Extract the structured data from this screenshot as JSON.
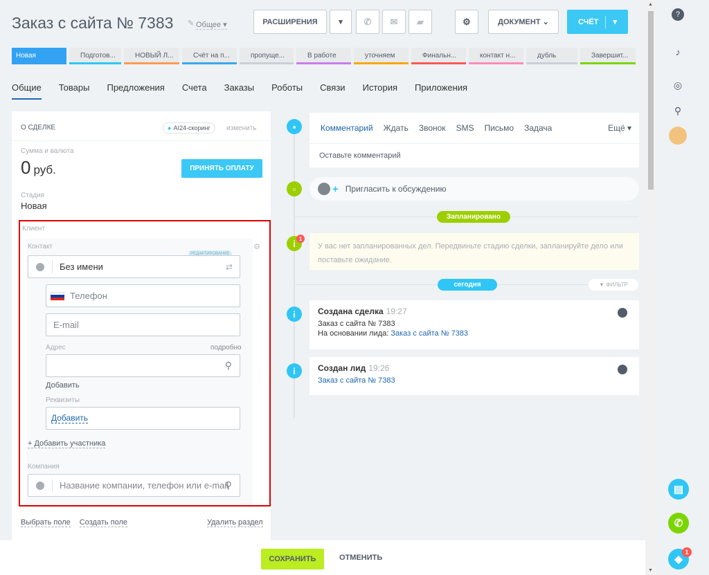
{
  "header": {
    "title": "Заказ с сайта № 7383",
    "edit_icon": "✎",
    "category": "Общее",
    "extensions_label": "РАСШИРЕНИЯ",
    "document_label": "ДОКУМЕНТ",
    "bill_label": "СЧЁТ"
  },
  "stages": [
    {
      "label": "Новая",
      "color": "#33a2f3"
    },
    {
      "label": "Подготов...",
      "color": "#2fc6f6"
    },
    {
      "label": "НОВЫЙ Л...",
      "color": "#ff9b53"
    },
    {
      "label": "Счёт на п...",
      "color": "#39a8ef"
    },
    {
      "label": "пропуще...",
      "color": "#c9d0d6"
    },
    {
      "label": "В работе",
      "color": "#c97cee"
    },
    {
      "label": "уточняем",
      "color": "#f7a700"
    },
    {
      "label": "Финальн...",
      "color": "#ff5752"
    },
    {
      "label": "контакт н...",
      "color": "#ff8ab9"
    },
    {
      "label": "дубль",
      "color": "#c9d0d6"
    },
    {
      "label": "Завершит...",
      "color": "#7bd500"
    }
  ],
  "tabs": [
    "Общие",
    "Товары",
    "Предложения",
    "Счета",
    "Заказы",
    "Роботы",
    "Связи",
    "История",
    "Приложения"
  ],
  "left": {
    "section_title": "О СДЕЛКЕ",
    "ai_badge": "AI24-скоринг",
    "change_link": "изменить",
    "sum_label": "Сумма и валюта",
    "sum_value": "0",
    "currency": "руб.",
    "pay_button": "ПРИНЯТЬ ОПЛАТУ",
    "stage_label": "Стадия",
    "stage_value": "Новая",
    "client_label": "Клиент",
    "contact_label": "Контакт",
    "edit_badge": "РЕДАКТИРОВАНИЕ",
    "name_value": "Без имени",
    "phone_placeholder": "Телефон",
    "email_placeholder": "E-mail",
    "address_label": "Адрес",
    "more_link": "подробно",
    "add_link": "Добавить",
    "requisites_label": "Реквизиты",
    "requisites_add": "Добавить",
    "add_member": "+ Добавить участника",
    "company_label": "Компания",
    "company_placeholder": "Название компании, телефон или e-mail",
    "select_field": "Выбрать поле",
    "create_field": "Создать поле",
    "delete_section": "Удалить раздел"
  },
  "timeline": {
    "editor_tabs": [
      "Комментарий",
      "Ждать",
      "Звонок",
      "SMS",
      "Письмо",
      "Задача"
    ],
    "editor_more": "Ещё",
    "editor_placeholder": "Оставьте комментарий",
    "invite": "Пригласить к обсуждению",
    "planned_pill": "Запланировано",
    "notice_badge": "1",
    "notice": "У вас нет запланированных дел. Передвиньте стадию сделки, запланируйте дело или поставьте ожидание.",
    "today_pill": "сегодня",
    "filter": "ФИЛЬТР",
    "events": [
      {
        "title": "Создана сделка",
        "time": "19:27",
        "line1": "Заказ с сайта № 7383",
        "line2_prefix": "На основании лида:",
        "line2_link": "Заказ с сайта № 7383"
      },
      {
        "title": "Создан лид",
        "time": "19:26",
        "line1_link": "Заказ с сайта № 7383"
      }
    ]
  },
  "footer": {
    "save": "СОХРАНИТЬ",
    "cancel": "ОТМЕНИТЬ"
  },
  "right_panel": {
    "notification_badge": "1"
  }
}
